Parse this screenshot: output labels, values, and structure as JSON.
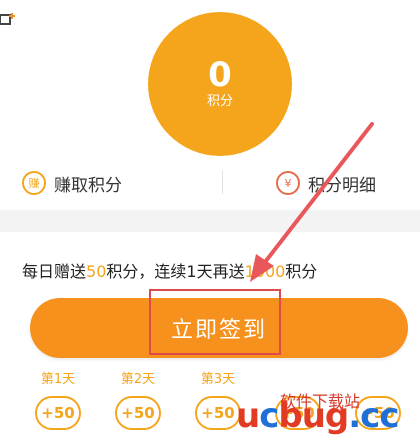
{
  "score": {
    "value": "0",
    "unit": "积分"
  },
  "actions": {
    "earn": {
      "icon": "赚",
      "label": "赚取积分"
    },
    "detail": {
      "icon": "¥",
      "label": "积分明细"
    }
  },
  "reward_rule": {
    "part1": "每日赠送",
    "daily_points": "50",
    "part2": "积分，连续1",
    "part3": "天再送",
    "bonus_points": "1000",
    "part4": "积分"
  },
  "checkin_button": {
    "label": "立即签到"
  },
  "days": [
    {
      "label": "第1天",
      "points": "+50"
    },
    {
      "label": "第2天",
      "points": "+50"
    },
    {
      "label": "第3天",
      "points": "+50"
    },
    {
      "label": "",
      "points": "+50"
    },
    {
      "label": "",
      "points": "+50"
    },
    {
      "label": "",
      "points": "+50"
    }
  ],
  "watermark": {
    "top": "软件下载站",
    "u": "u",
    "c": "c",
    "bug": "bug",
    "cc": ".cc"
  },
  "colors": {
    "accent": "#f4a51c",
    "button": "#f7911e",
    "highlight": "#e04a4a"
  }
}
